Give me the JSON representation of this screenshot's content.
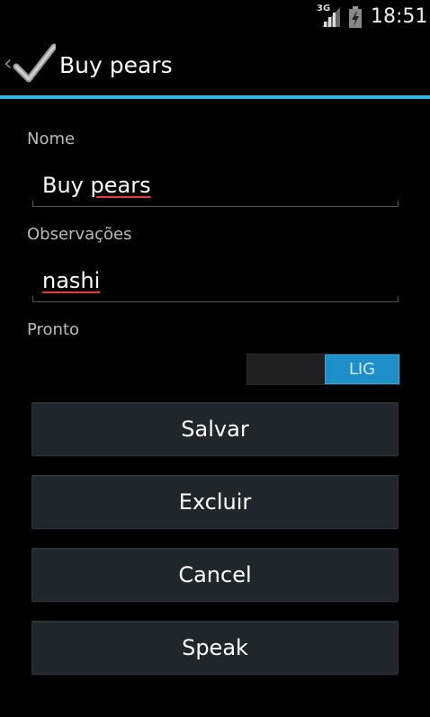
{
  "status_bar": {
    "network": "3G",
    "time": "18:51",
    "icons": [
      "signal-icon",
      "battery-icon"
    ]
  },
  "action_bar": {
    "title": "Buy pears",
    "icon": "checkmark-app-icon",
    "up_indicator": "‹"
  },
  "form": {
    "name_label": "Nome",
    "name_value": "Buy ",
    "name_value_misspelled": "pears",
    "notes_label": "Observações",
    "notes_value": "nashi",
    "done_label": "Pronto",
    "done_switch": "LIG"
  },
  "buttons": {
    "save": "Salvar",
    "delete": "Excluir",
    "cancel": "Cancel",
    "speak": "Speak"
  },
  "colors": {
    "accent": "#33b5e5",
    "switch_on": "#1e8fc8",
    "spellcheck": "#e23c3c"
  }
}
